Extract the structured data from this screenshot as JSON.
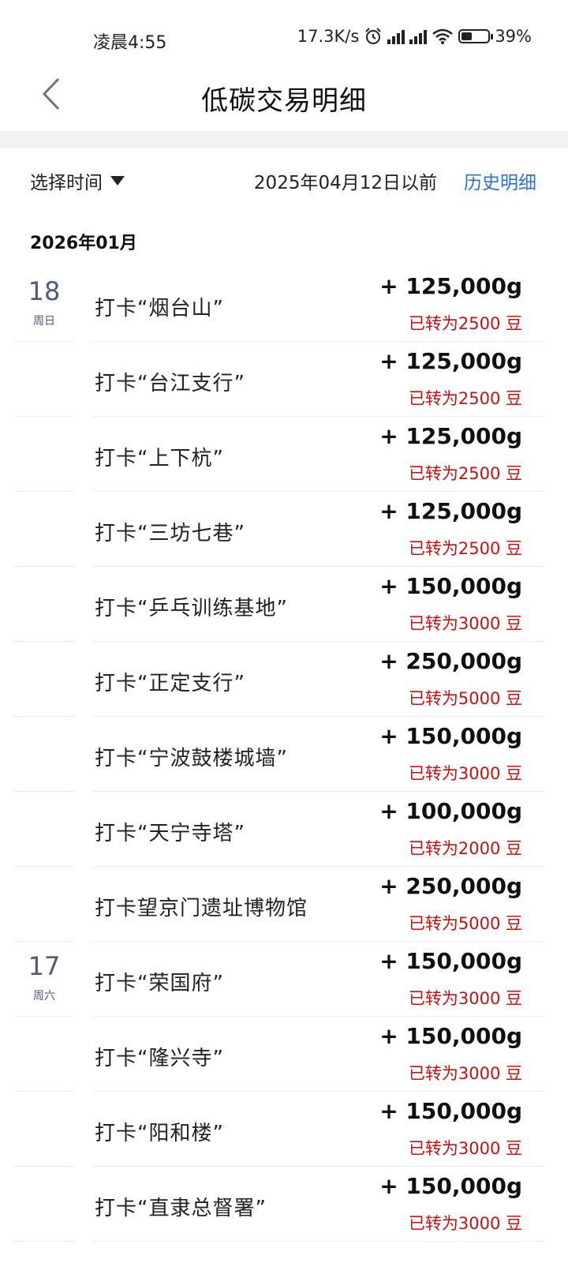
{
  "status": {
    "time": "凌晨4:55",
    "net_speed": "17.3K/s",
    "battery": "39%",
    "battery_level": 0.39,
    "icons": [
      "alarm-icon",
      "signal-hd-icon",
      "signal-hd-icon",
      "wifi-icon",
      "battery-icon"
    ]
  },
  "nav": {
    "title": "低碳交易明细",
    "back_icon": "chevron-left-icon"
  },
  "filter": {
    "select_label": "选择时间",
    "before_text": "2025年04月12日以前",
    "history_link": "历史明细"
  },
  "month": "2026年01月",
  "colors": {
    "accent": "#2d6fd6",
    "converted": "#cc1010",
    "day": "#4d5b78"
  },
  "rows": [
    {
      "day": "18",
      "weekday": "周日",
      "title": "打卡“烟台山”",
      "amount": "+ 125,000g",
      "converted": "已转为2500 豆"
    },
    {
      "day": "",
      "weekday": "",
      "title": "打卡“台江支行”",
      "amount": "+ 125,000g",
      "converted": "已转为2500 豆"
    },
    {
      "day": "",
      "weekday": "",
      "title": "打卡“上下杭”",
      "amount": "+ 125,000g",
      "converted": "已转为2500 豆"
    },
    {
      "day": "",
      "weekday": "",
      "title": "打卡“三坊七巷”",
      "amount": "+ 125,000g",
      "converted": "已转为2500 豆"
    },
    {
      "day": "",
      "weekday": "",
      "title": "打卡“乒乓训练基地”",
      "amount": "+ 150,000g",
      "converted": "已转为3000 豆"
    },
    {
      "day": "",
      "weekday": "",
      "title": "打卡“正定支行”",
      "amount": "+ 250,000g",
      "converted": "已转为5000 豆"
    },
    {
      "day": "",
      "weekday": "",
      "title": "打卡“宁波鼓楼城墙”",
      "amount": "+ 150,000g",
      "converted": "已转为3000 豆"
    },
    {
      "day": "",
      "weekday": "",
      "title": "打卡“天宁寺塔”",
      "amount": "+ 100,000g",
      "converted": "已转为2000 豆"
    },
    {
      "day": "",
      "weekday": "",
      "title": "打卡望京门遗址博物馆",
      "amount": "+ 250,000g",
      "converted": "已转为5000 豆"
    },
    {
      "day": "17",
      "weekday": "周六",
      "title": "打卡“荣国府”",
      "amount": "+ 150,000g",
      "converted": "已转为3000 豆"
    },
    {
      "day": "",
      "weekday": "",
      "title": "打卡“隆兴寺”",
      "amount": "+ 150,000g",
      "converted": "已转为3000 豆"
    },
    {
      "day": "",
      "weekday": "",
      "title": "打卡“阳和楼”",
      "amount": "+ 150,000g",
      "converted": "已转为3000 豆"
    },
    {
      "day": "",
      "weekday": "",
      "title": "打卡“直隶总督署”",
      "amount": "+ 150,000g",
      "converted": "已转为3000 豆"
    }
  ]
}
